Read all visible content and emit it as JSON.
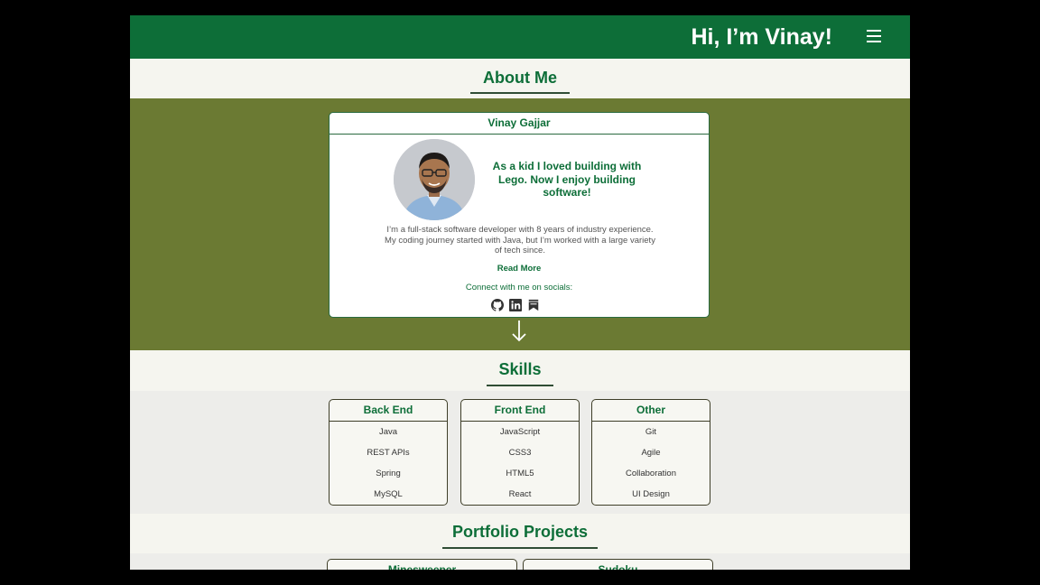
{
  "header": {
    "title": "Hi, I’m Vinay!",
    "menu_icon": "hamburger-menu-icon"
  },
  "about": {
    "heading": "About Me",
    "card": {
      "name": "Vinay Gajjar",
      "tagline": "As a kid I loved building with Lego. Now I enjoy building software!",
      "bio": "I’m a full-stack software developer with 8 years of industry experience. My coding journey started with Java, but I’m worked with a large variety of tech since.",
      "read_more": "Read More",
      "connect": "Connect with me on socials:",
      "socials": [
        "github-icon",
        "linkedin-icon",
        "bookmark-icon"
      ]
    },
    "scroll_icon": "arrow-down-icon"
  },
  "skills": {
    "heading": "Skills",
    "groups": [
      {
        "title": "Back End",
        "items": [
          "Java",
          "REST APIs",
          "Spring",
          "MySQL"
        ]
      },
      {
        "title": "Front End",
        "items": [
          "JavaScript",
          "CSS3",
          "HTML5",
          "React"
        ]
      },
      {
        "title": "Other",
        "items": [
          "Git",
          "Agile",
          "Collaboration",
          "UI Design"
        ]
      }
    ]
  },
  "projects": {
    "heading": "Portfolio Projects",
    "cards": [
      "Minesweeper",
      "Sudoku"
    ]
  },
  "colors": {
    "brand_green": "#0d6e38",
    "olive_band": "#6b7a33",
    "page_bg": "#f5f5ef"
  }
}
